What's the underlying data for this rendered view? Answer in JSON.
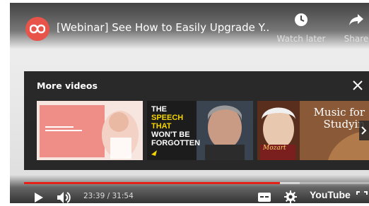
{
  "top_bar": {
    "title": "[Webinar] See How to Easily Upgrade Y...",
    "watch_later_label": "Watch later",
    "share_label": "Share"
  },
  "more_videos": {
    "heading": "More videos",
    "thumbnails": [
      {
        "overlay_text": ""
      },
      {
        "line1": "THE",
        "line2": "SPEECH",
        "line3": "THAT",
        "line4": "WON'T BE",
        "line5": "FORGOTTEN"
      },
      {
        "line1": "Music for",
        "line2": "Studyin",
        "sub": "Mozart"
      }
    ]
  },
  "controls": {
    "time_current": "23:39",
    "time_separator": " / ",
    "time_total": "31:54",
    "played_fraction": 0.741,
    "loaded_fraction": 0.8,
    "brand": "YouTube"
  },
  "colors": {
    "accent_red": "#e62117",
    "channel_logo": "#e8534a"
  }
}
